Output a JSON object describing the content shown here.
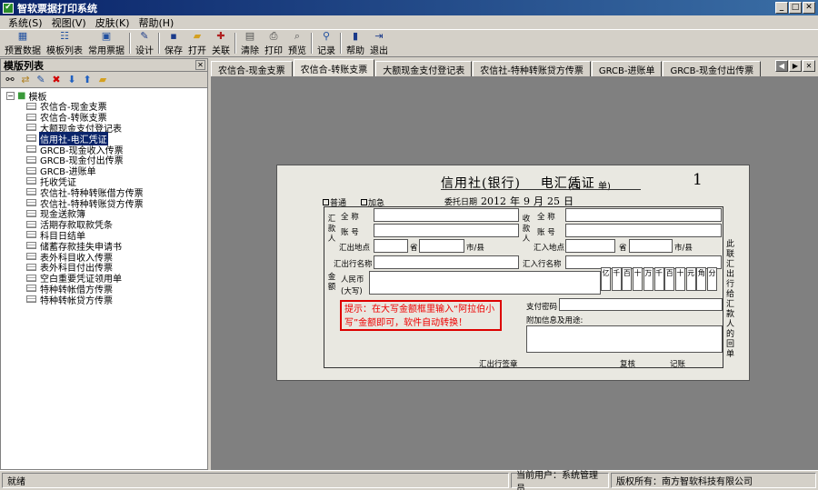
{
  "window": {
    "title": "智软票据打印系统"
  },
  "menu": [
    "系统(S)",
    "视图(V)",
    "皮肤(K)",
    "帮助(H)"
  ],
  "toolbar": {
    "preset": "预置数据",
    "template_list": "模板列表",
    "common": "常用票据",
    "design": "设计",
    "save": "保存",
    "open": "打开",
    "close": "关联",
    "clear": "清除",
    "print": "打印",
    "preview": "预览",
    "record": "记录",
    "help": "帮助",
    "exit": "退出"
  },
  "left_panel": {
    "title": "模版列表",
    "root": "模板",
    "items": [
      "农信合-现金支票",
      "农信合-转账支票",
      "大额现金支付登记表",
      "信用社-电汇凭证",
      "GRCB-现金收入传票",
      "GRCB-现金付出传票",
      "GRCB-进账单",
      "托收凭证",
      "农信社-特种转账借方传票",
      "农信社-特种转账贷方传票",
      "现金送款簿",
      "活期存款取款凭条",
      "科目日结单",
      "储蓄存款挂失申请书",
      "表外科目收入传票",
      "表外科目付出传票",
      "空白重要凭证领用单",
      "特种转帐借方传票",
      "特种转帐贷方传票"
    ],
    "selected_index": 3
  },
  "tabs": [
    "农信合-现金支票",
    "农信合-转账支票",
    "大额现金支付登记表",
    "农信社-特种转账贷方传票",
    "GRCB-进账单",
    "GRCB-现金付出传票"
  ],
  "active_tab": 1,
  "voucher": {
    "title_left": "信用社(银行)",
    "title_right": "电汇凭证",
    "copy_label": "(回",
    "copy_label2": "单)",
    "serial": "1",
    "chk_normal": "普通",
    "chk_urgent": "加急",
    "date_label": "委托日期",
    "year": "2012",
    "year_unit": "年",
    "month": "9",
    "month_unit": "月",
    "day": "25",
    "day_unit": "日",
    "remitter_side": "汇款人",
    "payee_side": "收款人",
    "full_name": "全  称",
    "account": "账  号",
    "remit_place": "汇出地点",
    "receive_place": "汇入地点",
    "province": "省",
    "city": "市/县",
    "remit_bank": "汇出行名称",
    "receive_bank": "汇入行名称",
    "amount_side": "金额",
    "rmb_label": "人民币",
    "rmb_label2": "(大写)",
    "digits": [
      "亿",
      "千",
      "百",
      "十",
      "万",
      "千",
      "百",
      "十",
      "元",
      "角",
      "分"
    ],
    "hint": "提示：在大写金额框里输入“阿拉伯小写”金额即可，软件自动转换！",
    "pay_pwd": "支付密码",
    "extra_info": "附加信息及用途:",
    "remit_seal": "汇出行签章",
    "review": "复核",
    "bookkeep": "记账",
    "side_note": "此联汇出行给汇款人的回单"
  },
  "status": {
    "ready": "就绪",
    "user": "当前用户：系统管理员",
    "copyright": "版权所有：南方智软科技有限公司"
  },
  "colors": {
    "titlebar": "#0a246a",
    "selected": "#0a246a",
    "hint_red": "#e00000",
    "workspace": "#808080"
  }
}
